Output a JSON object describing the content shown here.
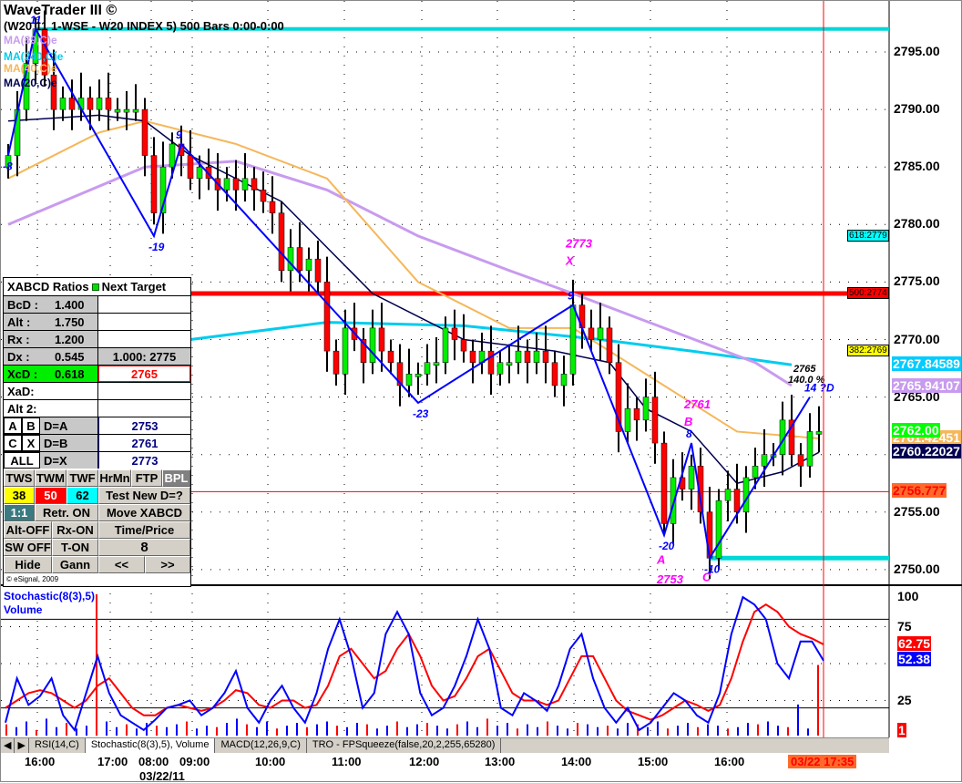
{
  "header": {
    "app_title": "WaveTrader III ©",
    "symbol_line": "(W20 11 1-WSE - W20 INDEX 5) 500 Bars 0:00-0:00"
  },
  "ma_legend": [
    {
      "label": "MA(89,C)e",
      "color": "#c89bef"
    },
    {
      "label": "MA(240,C)e",
      "color": "#00ccee"
    },
    {
      "label": "MA(40,C)e",
      "color": "#f5b75a"
    },
    {
      "label": "MA(20,C)e",
      "color": "#000050"
    }
  ],
  "price_axis": {
    "ticks": [
      "2795.00",
      "2790.00",
      "2785.00",
      "2780.00",
      "2775.00",
      "2770.00",
      "2765.00",
      "2760.00",
      "2755.00",
      "2750.00"
    ],
    "tick_values": [
      2795,
      2790,
      2785,
      2780,
      2775,
      2770,
      2765,
      2760,
      2755,
      2750
    ]
  },
  "price_tags": [
    {
      "text": "2767.84589",
      "value": 2767.846,
      "color": "#00ccff"
    },
    {
      "text": "2765.94107",
      "value": 2765.941,
      "color": "#c89bef"
    },
    {
      "text": "2761.42451",
      "value": 2761.42,
      "color": "#f5b75a"
    },
    {
      "text": "2762.00",
      "value": 2762.0,
      "color": "#00ff00"
    },
    {
      "text": "2760.22027",
      "value": 2760.22,
      "color": "#000050"
    },
    {
      "text": "2756.777",
      "value": 2756.777,
      "color": "#ff6a2a",
      "text_color": "#ff0000"
    }
  ],
  "fib_labels": [
    {
      "text": "618:2779",
      "value": 2779,
      "color": "#00ffff"
    },
    {
      "text": "500:2774",
      "value": 2774,
      "color": "#ff0000"
    },
    {
      "text": "382:2769",
      "value": 2769,
      "color": "#ffff00"
    }
  ],
  "chart_data": {
    "type": "candlestick",
    "closes": [
      2786,
      2790,
      2794,
      2797,
      2793,
      2790,
      2791,
      2790,
      2791,
      2790,
      2791,
      2790,
      2790,
      2790,
      2790,
      2786,
      2781,
      2785,
      2787,
      2786,
      2784,
      2785,
      2784,
      2783,
      2784,
      2783,
      2784,
      2783,
      2782,
      2781,
      2776,
      2778,
      2776,
      2777,
      2775,
      2769,
      2767,
      2771,
      2770,
      2768,
      2771,
      2769,
      2768,
      2766,
      2767,
      2767,
      2768,
      2768,
      2771,
      2770,
      2769,
      2768,
      2769,
      2767,
      2768,
      2768,
      2769,
      2768,
      2769,
      2768,
      2766,
      2767,
      2773,
      2771,
      2770,
      2771,
      2768,
      2762,
      2764,
      2763,
      2765,
      2761,
      2754,
      2758,
      2757,
      2759,
      2755,
      2751,
      2756,
      2757,
      2755,
      2758,
      2759,
      2760,
      2760,
      2763,
      2760,
      2759,
      2762,
      2762
    ],
    "ma20": [
      [
        0,
        2789
      ],
      [
        10,
        2789.5
      ],
      [
        15,
        2789
      ],
      [
        20,
        2786
      ],
      [
        30,
        2782
      ],
      [
        40,
        2774
      ],
      [
        50,
        2770
      ],
      [
        60,
        2769
      ],
      [
        66,
        2768
      ],
      [
        70,
        2764
      ],
      [
        75,
        2762
      ],
      [
        80,
        2757.5
      ],
      [
        85,
        2758.5
      ],
      [
        89,
        2760.2
      ]
    ],
    "ma40": [
      [
        0,
        2784
      ],
      [
        10,
        2788
      ],
      [
        15,
        2789
      ],
      [
        25,
        2787
      ],
      [
        35,
        2784
      ],
      [
        45,
        2775
      ],
      [
        55,
        2771
      ],
      [
        62,
        2771
      ],
      [
        70,
        2767
      ],
      [
        80,
        2762
      ],
      [
        89,
        2761.4
      ]
    ],
    "ma89": [
      [
        0,
        2780
      ],
      [
        15,
        2785
      ],
      [
        25,
        2785.5
      ],
      [
        35,
        2783
      ],
      [
        45,
        2779
      ],
      [
        55,
        2776
      ],
      [
        62,
        2774
      ],
      [
        72,
        2771
      ],
      [
        82,
        2768
      ],
      [
        86,
        2766
      ]
    ],
    "ma240": [
      [
        20,
        2770
      ],
      [
        35,
        2771.5
      ],
      [
        50,
        2771.2
      ],
      [
        65,
        2770
      ],
      [
        75,
        2769
      ],
      [
        86,
        2767.8
      ]
    ],
    "zigzag": [
      {
        "i": 0,
        "p": 2786,
        "label": "-8"
      },
      {
        "i": 3,
        "p": 2797,
        "label": "11"
      },
      {
        "i": 16,
        "p": 2779,
        "label": "-19"
      },
      {
        "i": 19,
        "p": 2787,
        "label": "9"
      },
      {
        "i": 45,
        "p": 2764.5,
        "label": "-23"
      },
      {
        "i": 62,
        "p": 2773,
        "label": "9"
      },
      {
        "i": 72,
        "p": 2753,
        "label": "-20"
      },
      {
        "i": 75,
        "p": 2761,
        "label": "8"
      },
      {
        "i": 77,
        "p": 2751,
        "label": "-10"
      },
      {
        "i": 88,
        "p": 2765,
        "label": "14 ?D"
      }
    ],
    "pattern_labels": [
      {
        "i": 62,
        "p": 2776.5,
        "text": "X"
      },
      {
        "i": 62,
        "p": 2778,
        "text": "2773"
      },
      {
        "i": 75,
        "p": 2762.5,
        "text": "B"
      },
      {
        "i": 75,
        "p": 2764,
        "text": "2761"
      },
      {
        "i": 72,
        "p": 2750.5,
        "text": "A"
      },
      {
        "i": 72,
        "p": 2748.8,
        "text": "2753"
      },
      {
        "i": 77,
        "p": 2749,
        "text": "C"
      }
    ],
    "target_note": [
      "2765",
      "140.0 %"
    ],
    "hlines": [
      {
        "p": 2797,
        "color": "#00d8d8",
        "from": 3,
        "width": 4
      },
      {
        "p": 2774,
        "color": "#ff0000",
        "from": 0,
        "width": 5
      },
      {
        "p": 2751,
        "color": "#00d8d8",
        "from": 77,
        "width": 5
      },
      {
        "p": 2756.777,
        "color": "#ff0000",
        "from": 0,
        "width": 1
      }
    ],
    "ylim": [
      2748.5,
      2798.5
    ],
    "x_ticks": [
      {
        "label": "16:00",
        "i": 3.2
      },
      {
        "label": "17:00",
        "i": 11.2
      },
      {
        "label": "08:00",
        "i": 15.7
      },
      {
        "label": "09:00",
        "i": 20.2
      },
      {
        "label": "10:00",
        "i": 28.5
      },
      {
        "label": "11:00",
        "i": 36.9
      },
      {
        "label": "12:00",
        "i": 45.4
      },
      {
        "label": "13:00",
        "i": 53.7
      },
      {
        "label": "14:00",
        "i": 62.1
      },
      {
        "label": "15:00",
        "i": 70.5
      },
      {
        "label": "16:00",
        "i": 78.9
      }
    ],
    "x_date": "03/22/11",
    "cursor_time": "03/22 17:35"
  },
  "stochastic": {
    "title": "Stochastic(8(3),5)",
    "volume_label": "Volume",
    "ticks": [
      "100",
      "75",
      "25"
    ],
    "k_last": "52.38",
    "d_last": "62.75",
    "volume_tag": "1",
    "k": [
      10,
      40,
      22,
      28,
      40,
      15,
      5,
      30,
      55,
      30,
      15,
      10,
      5,
      12,
      20,
      22,
      25,
      15,
      20,
      30,
      45,
      20,
      10,
      25,
      35,
      20,
      10,
      30,
      60,
      80,
      55,
      20,
      30,
      70,
      85,
      70,
      30,
      15,
      20,
      35,
      55,
      80,
      60,
      20,
      15,
      30,
      25,
      18,
      35,
      60,
      70,
      40,
      20,
      10,
      20,
      5,
      10,
      20,
      30,
      25,
      15,
      10,
      30,
      70,
      95,
      90,
      80,
      50,
      40,
      65,
      65,
      52
    ],
    "d": [
      20,
      25,
      30,
      32,
      30,
      25,
      20,
      25,
      35,
      40,
      30,
      20,
      15,
      15,
      20,
      22,
      20,
      18,
      20,
      25,
      32,
      30,
      22,
      20,
      25,
      25,
      20,
      22,
      35,
      55,
      60,
      50,
      40,
      45,
      60,
      70,
      55,
      35,
      25,
      28,
      40,
      55,
      60,
      45,
      30,
      25,
      25,
      22,
      25,
      40,
      55,
      55,
      40,
      25,
      18,
      15,
      12,
      15,
      20,
      25,
      22,
      18,
      22,
      40,
      65,
      85,
      90,
      85,
      75,
      70,
      67,
      63
    ],
    "volume": [
      8,
      6,
      10,
      4,
      12,
      6,
      9,
      5,
      7,
      100,
      10,
      6,
      8,
      5,
      9,
      7,
      6,
      8,
      10,
      5,
      7,
      6,
      9,
      12,
      8,
      6,
      10,
      5,
      7,
      9,
      6,
      8,
      10,
      7,
      6,
      9,
      8,
      5,
      7,
      10,
      6,
      8,
      9,
      7,
      5,
      8,
      10,
      6,
      12,
      7,
      9,
      5,
      8,
      6,
      10,
      7,
      5,
      9,
      8,
      6,
      7,
      5,
      9,
      8,
      6,
      10,
      5,
      7,
      9,
      6,
      8,
      7,
      5,
      6,
      9,
      8,
      10,
      7,
      6,
      22,
      5,
      50
    ]
  },
  "tabs": [
    "RSI(14,C)",
    "Stochastic(8(3),5), Volume",
    "MACD(12,26,9,C)",
    "TRO - FPSqueeze(false,20,2,255,65280)"
  ],
  "panel": {
    "title": "XABCD Ratios",
    "next_target": "Next Target",
    "rows": [
      {
        "k": "BcD :",
        "v": "1.400",
        "r": ""
      },
      {
        "k": "Alt  :",
        "v": "1.750",
        "r": ""
      },
      {
        "k": "Rx   :",
        "v": "1.200",
        "r": ""
      },
      {
        "k": "Dx   :",
        "v": "0.545",
        "r": "1.000: 2775"
      },
      {
        "k": "XcD :",
        "v": "0.618",
        "r": "2765"
      },
      {
        "k": "XaD:",
        "v": "",
        "r": ""
      },
      {
        "k": "Alt 2:",
        "v": "",
        "r": ""
      }
    ],
    "targets": [
      {
        "a": "A",
        "b": "B",
        "k": "D=A",
        "v": "2753"
      },
      {
        "a": "C",
        "b": "X",
        "k": "D=B",
        "v": "2761"
      },
      {
        "a": "ALL",
        "b": "",
        "k": "D=X",
        "v": "2773"
      }
    ],
    "buttons1": [
      "TWS",
      "TWM",
      "TWF",
      "HrMn",
      "FTP",
      "BPL"
    ],
    "fibs": [
      "38",
      "50",
      "62"
    ],
    "test_new": "Test New D=?",
    "b_11": "1:1",
    "b_retr": "Retr. ON",
    "b_move": "Move XABCD",
    "b_alt": "Alt-OFF",
    "b_rx": "Rx-ON",
    "b_time": "Time/Price",
    "b_sw": "SW OFF",
    "b_t": "T-ON",
    "b_num": "8",
    "b_hide": "Hide",
    "b_gann": "Gann",
    "b_prev": "<<",
    "b_next": ">>",
    "copyright": "© eSignal, 2009"
  }
}
